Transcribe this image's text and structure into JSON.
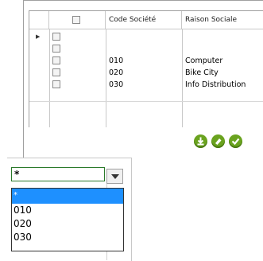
{
  "grid": {
    "columns": [
      "",
      "",
      "Code Société",
      "Raison Sociale"
    ],
    "rows": [
      {
        "code": "",
        "raison": "",
        "current": true
      },
      {
        "code": "",
        "raison": "",
        "current": false
      },
      {
        "code": "010",
        "raison": "Computer",
        "current": false
      },
      {
        "code": "020",
        "raison": "Bike City",
        "current": false
      },
      {
        "code": "030",
        "raison": "Info Distribution",
        "current": false
      }
    ]
  },
  "toolbar": {
    "buttons": [
      {
        "name": "download-icon",
        "color": "#6aa31f"
      },
      {
        "name": "eraser-icon",
        "color": "#6aa31f"
      },
      {
        "name": "check-icon",
        "color": "#6aa31f"
      }
    ]
  },
  "combo": {
    "value": "*",
    "options": [
      "*",
      "010",
      "020",
      "030"
    ],
    "selected_index": 0,
    "highlight_color": "#1e90ff",
    "border_color": "#2b7a2b"
  }
}
